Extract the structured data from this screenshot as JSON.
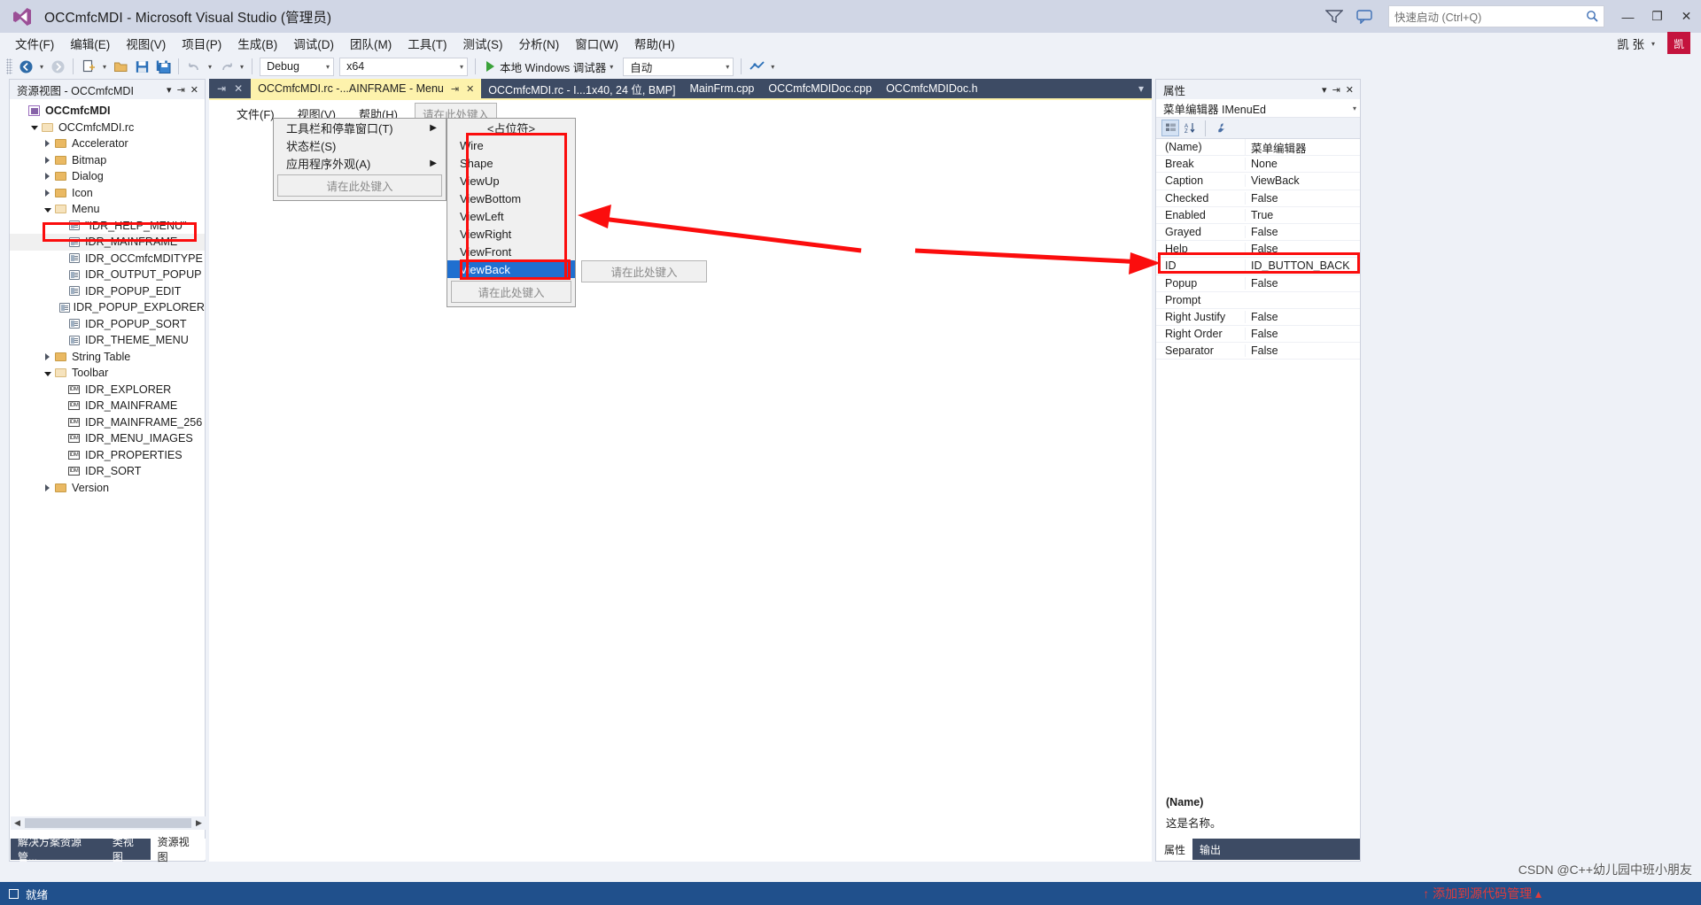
{
  "window": {
    "title": "OCCmfcMDI - Microsoft Visual Studio (管理员)",
    "logo_icon": "visual-studio-logo",
    "notify_icon": "notifications-icon",
    "feedback_icon": "feedback-icon",
    "minimize": "—",
    "restore": "❐",
    "close": "✕"
  },
  "quick_launch": {
    "placeholder": "快速启动 (Ctrl+Q)",
    "value": "",
    "icon": "search-icon"
  },
  "menubar": {
    "items": [
      {
        "label": "文件(F)",
        "key": "F"
      },
      {
        "label": "编辑(E)",
        "key": "E"
      },
      {
        "label": "视图(V)",
        "key": "V"
      },
      {
        "label": "项目(P)",
        "key": "P"
      },
      {
        "label": "生成(B)",
        "key": "B"
      },
      {
        "label": "调试(D)",
        "key": "D"
      },
      {
        "label": "团队(M)",
        "key": "M"
      },
      {
        "label": "工具(T)",
        "key": "T"
      },
      {
        "label": "测试(S)",
        "key": "S"
      },
      {
        "label": "分析(N)",
        "key": "N"
      },
      {
        "label": "窗口(W)",
        "key": "W"
      },
      {
        "label": "帮助(H)",
        "key": "H"
      }
    ],
    "user": "凯 张",
    "user_caret": "▾",
    "avatar_text": "凯"
  },
  "toolbar": {
    "nav_back_icon": "navigate-back-icon",
    "nav_forward_icon": "navigate-forward-icon",
    "new_item_icon": "new-item-icon",
    "open_icon": "open-file-icon",
    "save_icon": "save-icon",
    "save_all_icon": "save-all-icon",
    "undo_icon": "undo-icon",
    "redo_icon": "redo-icon",
    "config": "Debug",
    "platform": "x64",
    "run_label": "本地 Windows 调试器",
    "attach": "自动",
    "play_icon": "run-play-icon",
    "caret": "▾"
  },
  "resource_view": {
    "header": "资源视图 - OCCmfcMDI",
    "header_caret_icon": "chevron-down-icon",
    "pin_icon": "pin-icon",
    "close_icon": "close-icon",
    "tree": [
      {
        "label": "OCCmfcMDI",
        "depth": 0,
        "twisty": "none",
        "icon": "project-icon",
        "bold": true
      },
      {
        "label": "OCCmfcMDI.rc",
        "depth": 1,
        "twisty": "expanded",
        "icon": "folder-open"
      },
      {
        "label": "Accelerator",
        "depth": 2,
        "twisty": "collapsed",
        "icon": "folder-closed"
      },
      {
        "label": "Bitmap",
        "depth": 2,
        "twisty": "collapsed",
        "icon": "folder-closed"
      },
      {
        "label": "Dialog",
        "depth": 2,
        "twisty": "collapsed",
        "icon": "folder-closed"
      },
      {
        "label": "Icon",
        "depth": 2,
        "twisty": "collapsed",
        "icon": "folder-closed"
      },
      {
        "label": "Menu",
        "depth": 2,
        "twisty": "expanded",
        "icon": "folder-open"
      },
      {
        "label": "\"IDR_HELP_MENU\"",
        "depth": 3,
        "twisty": "none",
        "icon": "resource-icon"
      },
      {
        "label": "IDR_MAINFRAME",
        "depth": 3,
        "twisty": "none",
        "icon": "resource-icon",
        "selected": true
      },
      {
        "label": "IDR_OCCmfcMDITYPE",
        "depth": 3,
        "twisty": "none",
        "icon": "resource-icon"
      },
      {
        "label": "IDR_OUTPUT_POPUP",
        "depth": 3,
        "twisty": "none",
        "icon": "resource-icon"
      },
      {
        "label": "IDR_POPUP_EDIT",
        "depth": 3,
        "twisty": "none",
        "icon": "resource-icon"
      },
      {
        "label": "IDR_POPUP_EXPLORER",
        "depth": 3,
        "twisty": "none",
        "icon": "resource-icon"
      },
      {
        "label": "IDR_POPUP_SORT",
        "depth": 3,
        "twisty": "none",
        "icon": "resource-icon"
      },
      {
        "label": "IDR_THEME_MENU",
        "depth": 3,
        "twisty": "none",
        "icon": "resource-icon"
      },
      {
        "label": "String Table",
        "depth": 2,
        "twisty": "collapsed",
        "icon": "folder-closed"
      },
      {
        "label": "Toolbar",
        "depth": 2,
        "twisty": "expanded",
        "icon": "folder-open"
      },
      {
        "label": "IDR_EXPLORER",
        "depth": 3,
        "twisty": "none",
        "icon": "toolbar-icon"
      },
      {
        "label": "IDR_MAINFRAME",
        "depth": 3,
        "twisty": "none",
        "icon": "toolbar-icon"
      },
      {
        "label": "IDR_MAINFRAME_256",
        "depth": 3,
        "twisty": "none",
        "icon": "toolbar-icon"
      },
      {
        "label": "IDR_MENU_IMAGES",
        "depth": 3,
        "twisty": "none",
        "icon": "toolbar-icon"
      },
      {
        "label": "IDR_PROPERTIES",
        "depth": 3,
        "twisty": "none",
        "icon": "toolbar-icon"
      },
      {
        "label": "IDR_SORT",
        "depth": 3,
        "twisty": "none",
        "icon": "toolbar-icon"
      },
      {
        "label": "Version",
        "depth": 2,
        "twisty": "collapsed",
        "icon": "folder-closed"
      }
    ],
    "scroll_left_icon": "◀",
    "scroll_right_icon": "▶",
    "bottom_tabs": [
      {
        "label": "解决方案资源管...",
        "active": false
      },
      {
        "label": "类视图",
        "active": false
      },
      {
        "label": "资源视图",
        "active": true
      }
    ]
  },
  "document_tabs": {
    "pin_icon": "pin-icon",
    "close_icon": "close-icon",
    "items": [
      {
        "label": "OCCmfcMDI.rc -...AINFRAME - Menu",
        "active": true,
        "pin": "⇥",
        "close": "✕"
      },
      {
        "label": "OCCmfcMDI.rc - I...1x40, 24 位, BMP]",
        "active": false
      },
      {
        "label": "MainFrm.cpp",
        "active": false
      },
      {
        "label": "OCCmfcMDIDoc.cpp",
        "active": false
      },
      {
        "label": "OCCmfcMDIDoc.h",
        "active": false
      }
    ],
    "overflow_icon": "chevron-down-icon"
  },
  "menu_editor": {
    "top_menus": [
      {
        "label": "文件(F)"
      },
      {
        "label": "视图(V)"
      },
      {
        "label": "帮助(H)"
      }
    ],
    "type_here": "请在此处键入",
    "dropdown": {
      "items": [
        {
          "label": "工具栏和停靠窗口(T)",
          "submenu": true
        },
        {
          "label": "状态栏(S)",
          "submenu": false
        },
        {
          "label": "应用程序外观(A)",
          "submenu": true
        }
      ],
      "type_here": "请在此处键入"
    },
    "submenu": {
      "placeholder_label": "<占位符>",
      "items": [
        {
          "label": "Wire",
          "selected": false
        },
        {
          "label": "Shape",
          "selected": false
        },
        {
          "label": "ViewUp",
          "selected": false
        },
        {
          "label": "ViewBottom",
          "selected": false
        },
        {
          "label": "ViewLeft",
          "selected": false
        },
        {
          "label": "ViewRight",
          "selected": false
        },
        {
          "label": "ViewFront",
          "selected": false
        },
        {
          "label": "ViewBack",
          "selected": true
        }
      ],
      "type_here": "请在此处键入",
      "sub_type_here": "请在此处键入"
    }
  },
  "properties": {
    "header": "属性",
    "pin_icon": "pin-icon",
    "close_icon": "close-icon",
    "caret_icon": "chevron-down-icon",
    "object": "菜单编辑器 IMenuEd",
    "object_caret": "▾",
    "toolbar": {
      "categorized_icon": "categorized-view-icon",
      "alphabetical_icon": "alphabetical-sort-icon",
      "properties_icon": "properties-wrench-icon"
    },
    "rows": [
      {
        "name": "(Name)",
        "value": "菜单编辑器"
      },
      {
        "name": "Break",
        "value": "None"
      },
      {
        "name": "Caption",
        "value": "ViewBack"
      },
      {
        "name": "Checked",
        "value": "False"
      },
      {
        "name": "Enabled",
        "value": "True"
      },
      {
        "name": "Grayed",
        "value": "False"
      },
      {
        "name": "Help",
        "value": "False"
      },
      {
        "name": "ID",
        "value": "ID_BUTTON_BACK",
        "highlight": true
      },
      {
        "name": "Popup",
        "value": "False"
      },
      {
        "name": "Prompt",
        "value": ""
      },
      {
        "name": "Right Justify",
        "value": "False"
      },
      {
        "name": "Right Order",
        "value": "False"
      },
      {
        "name": "Separator",
        "value": "False"
      }
    ],
    "description_title": "(Name)",
    "description_body": "这是名称。",
    "bottom_tabs": [
      {
        "label": "属性",
        "active": true
      },
      {
        "label": "输出",
        "active": false
      }
    ]
  },
  "statusbar": {
    "icon": "ready-icon",
    "text": "就绪"
  },
  "annotations": {
    "watermark": "CSDN @C++幼儿园中班小朋友",
    "watermark2": "↑ 添加到源代码管理 ▴",
    "accent_red": "#fb0d0d"
  }
}
